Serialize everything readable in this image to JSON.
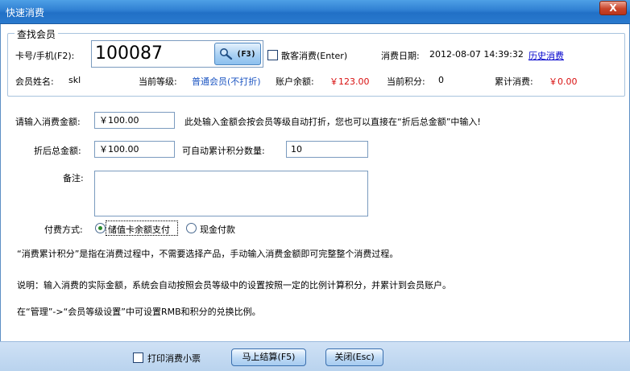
{
  "window": {
    "title": "快速消费",
    "close_label": "X"
  },
  "member_search": {
    "legend": "查找会员",
    "card_label": "卡号/手机(F2):",
    "card_value": "100087",
    "search_button_label": "(F3)",
    "walk_in_label": "散客消费(Enter)",
    "date_label": "消费日期:",
    "date_value": "2012-08-07 14:39:32",
    "history_link": "历史消费",
    "name_label": "会员姓名:",
    "name_value": "skl",
    "level_label": "当前等级:",
    "level_value": "普通会员(不打折)",
    "balance_label": "账户余额:",
    "balance_value": "￥123.00",
    "points_label": "当前积分:",
    "points_value": "0",
    "total_label": "累计消费:",
    "total_value": "￥0.00"
  },
  "form": {
    "amount_label": "请输入消费金额:",
    "amount_value": "￥100.00",
    "amount_hint": "此处输入金额会按会员等级自动打折，您也可以直接在“折后总金额”中输入!",
    "discount_label": "折后总金额:",
    "discount_value": "￥100.00",
    "auto_points_label": "可自动累计积分数量:",
    "auto_points_value": "10",
    "remark_label": "备注:",
    "remark_value": "",
    "pay_label": "付费方式:",
    "pay_options": [
      "储值卡余额支付",
      "现金付款"
    ]
  },
  "notes": {
    "line1": "“消费累计积分”是指在消费过程中，不需要选择产品，手动输入消费金额即可完整整个消费过程。",
    "line2": "说明：输入消费的实际金额，系统会自动按照会员等级中的设置按照一定的比例计算积分，并累计到会员账户。",
    "line3": "在“管理”->“会员等级设置”中可设置RMB和积分的兑换比例。"
  },
  "footer": {
    "print_label": "打印消费小票",
    "checkout_label": "马上结算(F5)",
    "close_label": "关闭(Esc)"
  }
}
